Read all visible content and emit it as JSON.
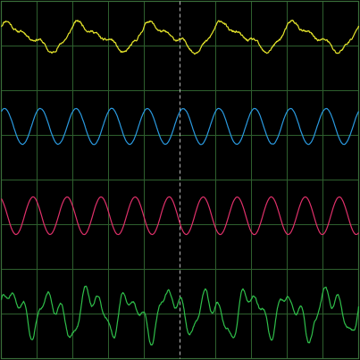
{
  "chart_data": {
    "type": "line",
    "title": "",
    "xlabel": "",
    "ylabel": "",
    "grid": true,
    "legend": "none",
    "grid_divisions": {
      "x": 10,
      "y": 8
    },
    "colors": {
      "background": "#000000",
      "grid": "#2e5f2e",
      "center_marker": "#d8d8d8",
      "frame": "#3a6e3a"
    },
    "x_range": [
      0,
      10
    ],
    "series": [
      {
        "color": "#e6e62c",
        "channel_center_div": 7.2,
        "amplitude_div": 0.33,
        "cycles": 5,
        "shape": "sawtooth-ish noisy",
        "noise": 0.06,
        "seed": 11
      },
      {
        "color": "#2a9ae0",
        "channel_center_div": 5.2,
        "amplitude_div": 0.4,
        "cycles": 10,
        "shape": "sine",
        "noise": 0.01,
        "seed": 23
      },
      {
        "color": "#e0306a",
        "channel_center_div": 3.2,
        "amplitude_div": 0.42,
        "cycles": 10.5,
        "shape": "sine",
        "noise": 0.005,
        "seed": 37
      },
      {
        "color": "#2fbf4a",
        "channel_center_div": 1.05,
        "amplitude_div": 0.55,
        "cycles": 9,
        "shape": "complex",
        "noise": 0.03,
        "seed": 51
      }
    ]
  }
}
